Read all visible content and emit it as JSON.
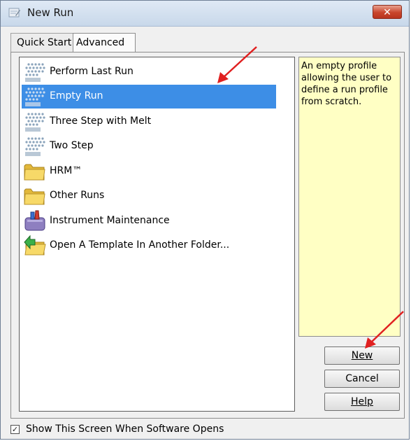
{
  "window": {
    "title": "New Run",
    "close_icon": "close-icon",
    "app_icon": "run-icon"
  },
  "tabs": [
    {
      "label": "Quick Start",
      "selected": false
    },
    {
      "label": "Advanced",
      "selected": true
    }
  ],
  "list": {
    "items": [
      {
        "label": "Perform Last Run",
        "icon": "qiagen-dots-icon",
        "selected": false
      },
      {
        "label": "Empty Run",
        "icon": "qiagen-dots-icon",
        "selected": true
      },
      {
        "label": "Three Step with Melt",
        "icon": "qiagen-dots-icon",
        "selected": false
      },
      {
        "label": "Two Step",
        "icon": "qiagen-dots-icon",
        "selected": false
      },
      {
        "label": "HRM™",
        "icon": "folder-icon",
        "selected": false
      },
      {
        "label": "Other Runs",
        "icon": "folder-icon",
        "selected": false
      },
      {
        "label": "Instrument Maintenance",
        "icon": "maintenance-icon",
        "selected": false
      },
      {
        "label": "Open A Template In Another Folder...",
        "icon": "open-folder-icon",
        "selected": false
      }
    ]
  },
  "description": "An empty profile allowing the user to define a run profile from scratch.",
  "buttons": {
    "new": "New",
    "cancel": "Cancel",
    "help": "Help"
  },
  "footer": {
    "checkbox_label": "Show This Screen When Software Opens",
    "checked": true
  },
  "colors": {
    "selection": "#3d8ee6",
    "description_bg": "#ffffc4",
    "arrow": "#e02020"
  }
}
